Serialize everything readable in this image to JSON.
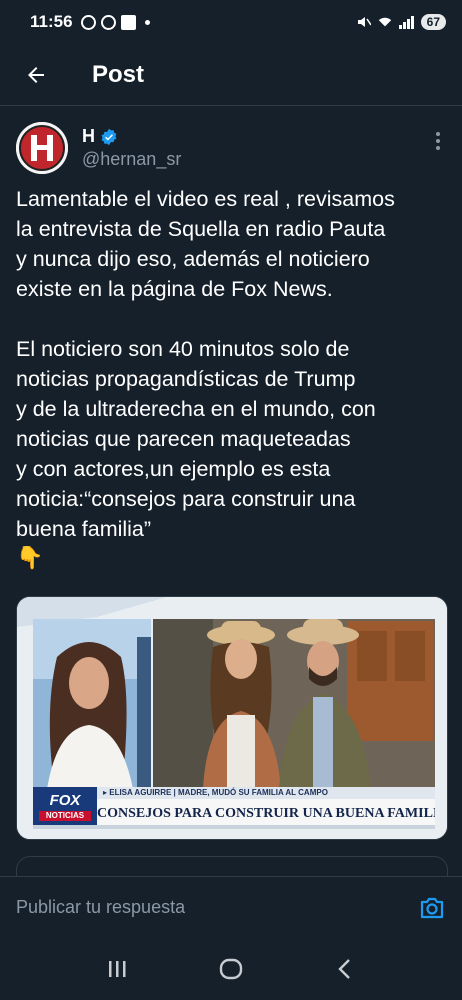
{
  "status": {
    "time": "11:56",
    "battery": "67"
  },
  "header": {
    "title": "Post"
  },
  "author": {
    "name": "H",
    "handle": "@hernan_sr"
  },
  "post": {
    "paragraph1": [
      "Lamentable el video es real , revisamos",
      "la entrevista de Squella en radio Pauta",
      "y nunca dijo eso, además el noticiero",
      "existe en la página de Fox News."
    ],
    "paragraph2": [
      "El noticiero son 40 minutos solo de",
      "noticias propagandísticas de Trump",
      "y de la ultraderecha en el mundo, con",
      "noticias que parecen maqueteadas",
      "y con actores,un ejemplo es esta",
      "noticia:“consejos para construir una",
      "buena familia”"
    ],
    "emoji": "👇"
  },
  "media": {
    "channel_logo": "FOX",
    "channel_sub": "NOTICIAS",
    "ticker": "▸ ELISA AGUIRRE | MADRE, MUDÓ SU FAMILIA AL CAMPO",
    "headline": "CONSEJOS PARA CONSTRUIR UNA BUENA FAMILIA"
  },
  "reply": {
    "placeholder": "Publicar tu respuesta"
  },
  "icons": {
    "back": "arrow-left-icon",
    "verified": "verified-badge-icon",
    "more": "more-vertical-icon",
    "camera": "camera-icon",
    "nav_recents": "recents-icon",
    "nav_home": "home-icon",
    "nav_back": "nav-back-icon"
  },
  "colors": {
    "background": "#15202b",
    "accent": "#1d9bf0",
    "muted": "#8b98a5"
  }
}
